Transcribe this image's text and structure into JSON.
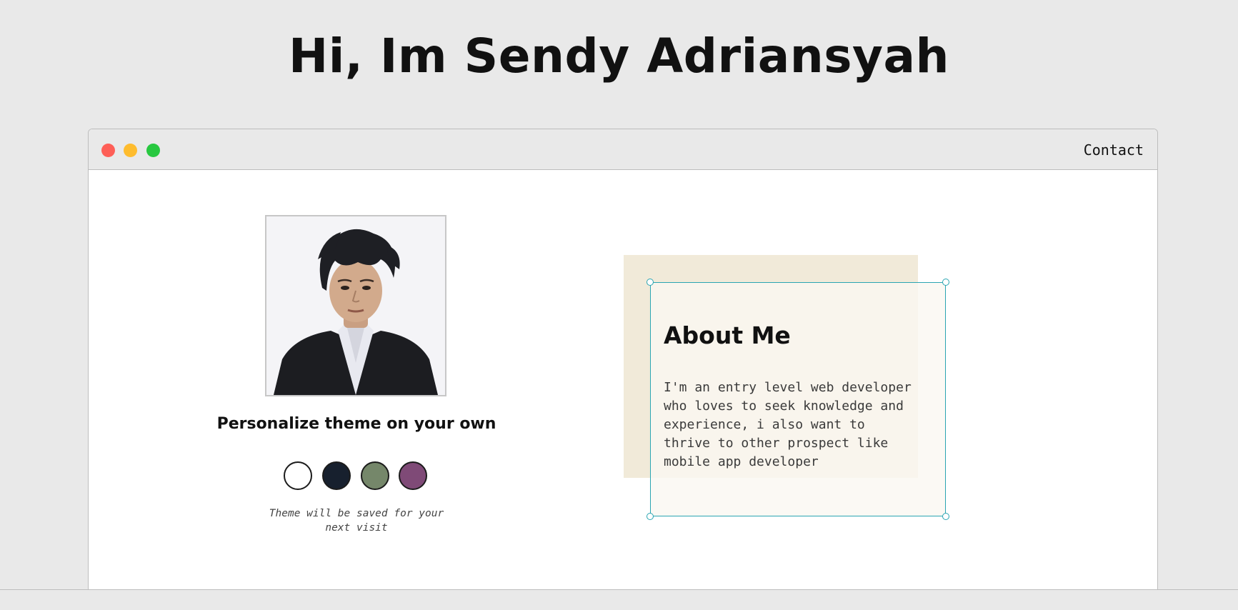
{
  "header": {
    "title": "Hi, Im Sendy Adriansyah"
  },
  "window": {
    "controls": [
      {
        "name": "close",
        "color": "#fe5f57"
      },
      {
        "name": "minimize",
        "color": "#febc2e"
      },
      {
        "name": "maximize",
        "color": "#28c840"
      }
    ],
    "nav": {
      "contact_label": "Contact"
    }
  },
  "profile": {
    "photo_icon": "portrait-photo",
    "theme_heading": "Personalize theme on your own",
    "theme_note": "Theme will be saved for your next visit",
    "themes": [
      {
        "name": "white",
        "color": "#ffffff"
      },
      {
        "name": "navy",
        "color": "#17202e"
      },
      {
        "name": "sage",
        "color": "#75876a"
      },
      {
        "name": "plum",
        "color": "#7f4a77"
      }
    ]
  },
  "about": {
    "title": "About Me",
    "text": "I'm an entry level web developer who loves to seek knowledge and experience, i also want to thrive to other prospect like mobile app developer",
    "card_color": "#f1ead9",
    "selection_color": "#2aa5b2"
  }
}
